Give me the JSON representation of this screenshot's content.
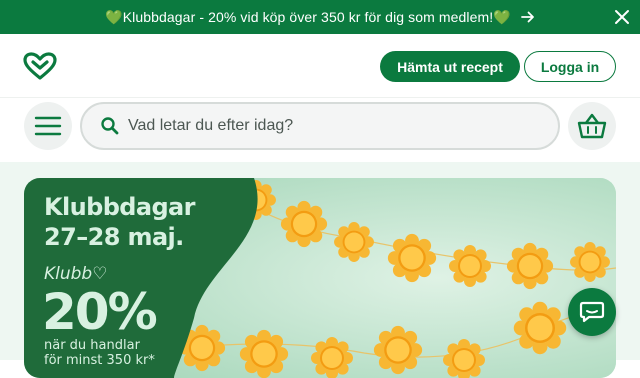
{
  "promo": {
    "text": "💚Klubbdagar - 20% vid köp över 350 kr för dig som medlem!💚",
    "arrow_icon": "arrow-right-icon",
    "close_icon": "close-icon"
  },
  "header": {
    "logo_icon": "heart-logo-icon",
    "recipe_button": "Hämta ut recept",
    "login_button": "Logga in"
  },
  "search": {
    "menu_icon": "hamburger-menu-icon",
    "placeholder": "Vad letar du efter idag?",
    "search_icon": "search-icon",
    "cart_icon": "basket-icon"
  },
  "banner": {
    "title": "Klubbdagar",
    "dates": "27–28 maj.",
    "klubb_logo": "Klubb♡",
    "percent": "20%",
    "line1": "när du handlar",
    "line2": "för minst 350 kr*"
  },
  "chat": {
    "icon": "chat-bubble-icon"
  },
  "colors": {
    "brand_green": "#0b7a3f",
    "banner_dark_green": "#1f6b3a",
    "banner_light": "#bfe3cd",
    "flower_orange": "#f5b324"
  }
}
